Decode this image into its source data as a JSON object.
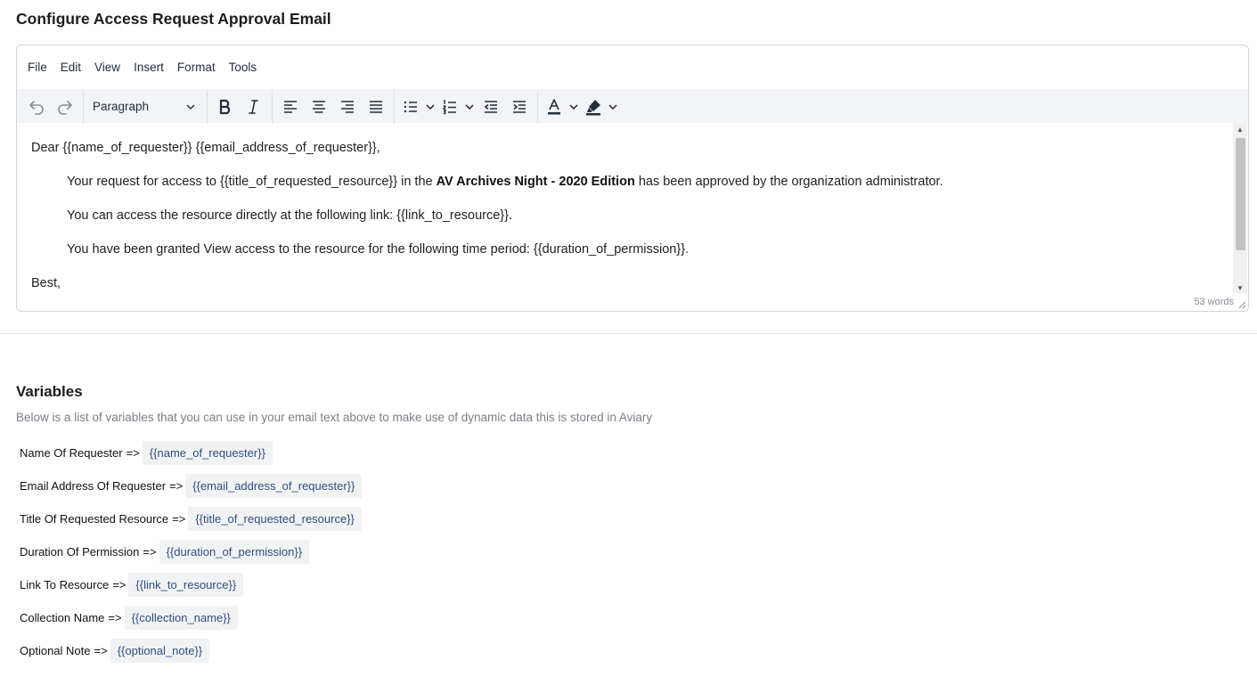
{
  "page_title": "Configure Access Request Approval Email",
  "editor": {
    "menu": [
      "File",
      "Edit",
      "View",
      "Insert",
      "Format",
      "Tools"
    ],
    "block_format": "Paragraph",
    "content": {
      "greeting": "Dear {{name_of_requester}} {{email_address_of_requester}},",
      "p1_before": "Your request for access to {{title_of_requested_resource}} in the ",
      "p1_bold": "AV Archives Night - 2020 Edition",
      "p1_after": " has been approved by the organization administrator.",
      "p2": "You can access the resource directly at the following link: {{link_to_resource}}.",
      "p3": "You have been granted View access to the resource for the following time period: {{duration_of_permission}}.",
      "closing": "Best,"
    },
    "word_count": "53 words"
  },
  "variables": {
    "title": "Variables",
    "description": "Below is a list of variables that you can use in your email text above to make use of dynamic data this is stored in Aviary",
    "arrow": "=>",
    "items": [
      {
        "label": "Name Of Requester",
        "token": "{{name_of_requester}}"
      },
      {
        "label": "Email Address Of Requester",
        "token": "{{email_address_of_requester}}"
      },
      {
        "label": "Title Of Requested Resource",
        "token": "{{title_of_requested_resource}}"
      },
      {
        "label": "Duration Of Permission",
        "token": "{{duration_of_permission}}"
      },
      {
        "label": "Link To Resource",
        "token": "{{link_to_resource}}"
      },
      {
        "label": "Collection Name",
        "token": "{{collection_name}}"
      },
      {
        "label": "Optional Note",
        "token": "{{optional_note}}"
      }
    ]
  },
  "colors": {
    "toolbar_bg": "#f2f4f8",
    "token_bg": "#f1f2f4",
    "token_text": "#2f4f7f"
  }
}
